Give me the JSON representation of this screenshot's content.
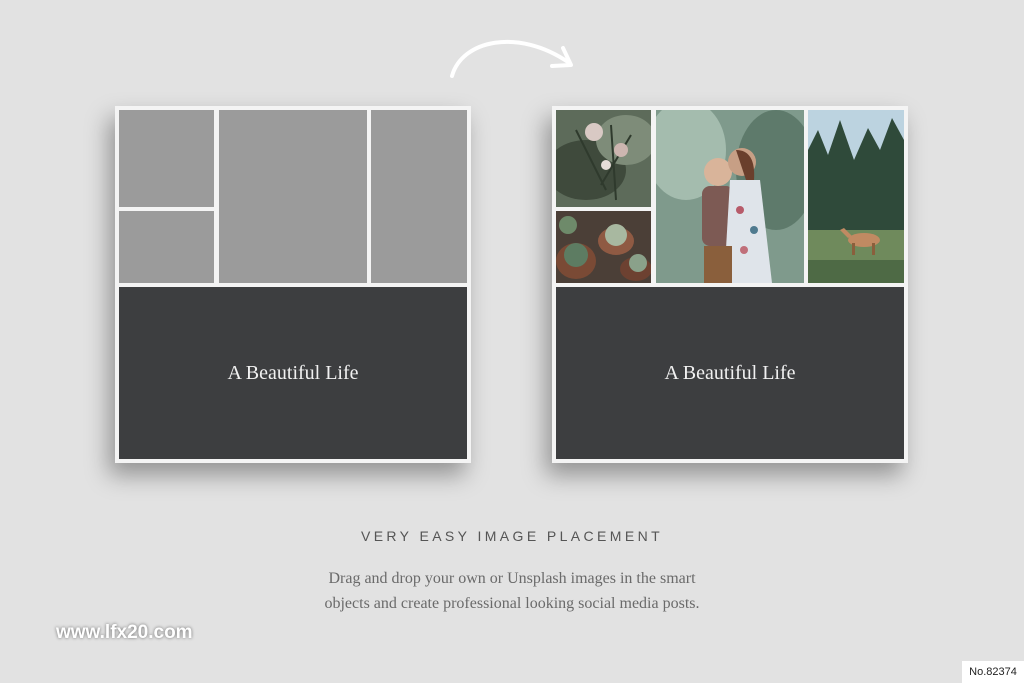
{
  "left_card": {
    "title": "A Beautiful Life"
  },
  "right_card": {
    "title": "A Beautiful Life"
  },
  "caption": {
    "heading": "VERY EASY IMAGE PLACEMENT",
    "line1": "Drag and drop your own or Unsplash images in the smart",
    "line2": "objects and create professional looking social media posts."
  },
  "watermark": "www.lfx20.com",
  "stamp": "No.82374",
  "colors": {
    "background": "#e2e2e2",
    "placeholder": "#9b9b9b",
    "block": "#3d3e40",
    "frame": "#f4f4f4"
  },
  "icons": {
    "arrow": "curved-arrow-icon"
  }
}
